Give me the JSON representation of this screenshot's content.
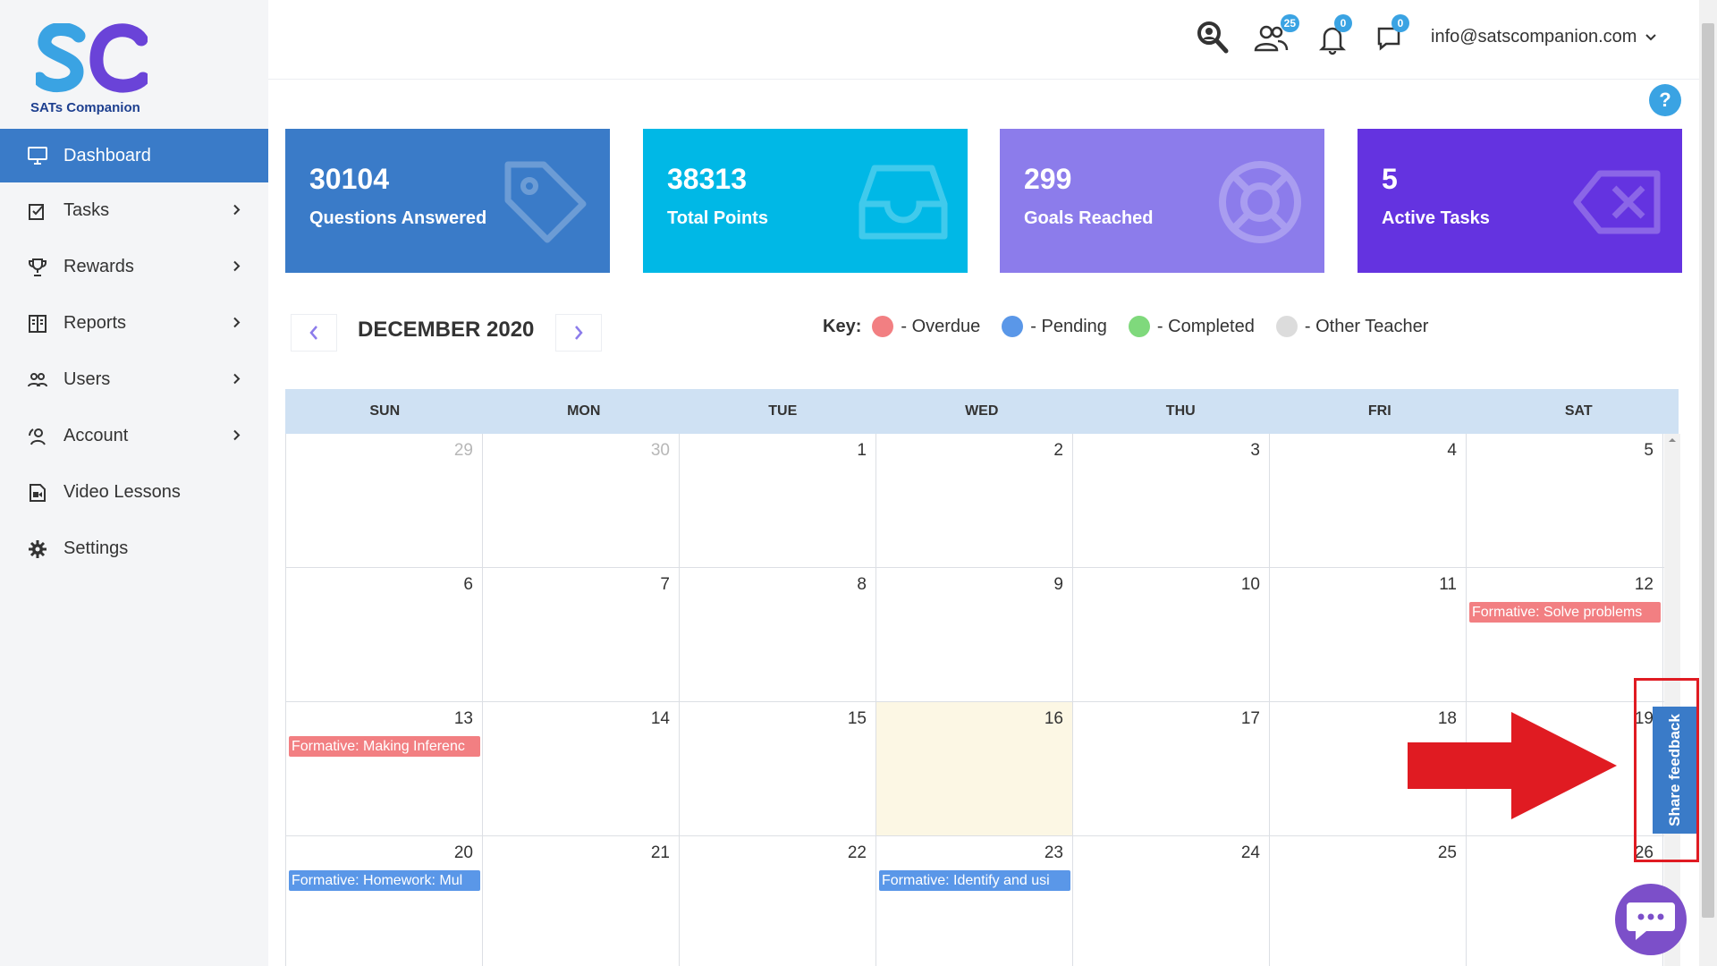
{
  "brand": {
    "name": "SATs Companion",
    "logo_letters": "SC"
  },
  "sidebar": {
    "items": [
      {
        "label": "Dashboard",
        "icon": "monitor-icon",
        "active": true
      },
      {
        "label": "Tasks",
        "icon": "tasks-icon"
      },
      {
        "label": "Rewards",
        "icon": "trophy-icon"
      },
      {
        "label": "Reports",
        "icon": "reports-icon"
      },
      {
        "label": "Users",
        "icon": "users-icon"
      },
      {
        "label": "Account",
        "icon": "account-icon"
      },
      {
        "label": "Video Lessons",
        "icon": "video-icon"
      },
      {
        "label": "Settings",
        "icon": "gear-icon"
      }
    ]
  },
  "topbar": {
    "users_badge": "25",
    "notifications_badge": "0",
    "messages_badge": "0",
    "user_email": "info@satscompanion.com",
    "help_label": "?"
  },
  "stats": [
    {
      "value": "30104",
      "label": "Questions Answered",
      "color": "#3a7bc8"
    },
    {
      "value": "38313",
      "label": "Total Points",
      "color": "#00b8e6"
    },
    {
      "value": "299",
      "label": "Goals Reached",
      "color": "#8c7ceb"
    },
    {
      "value": "5",
      "label": "Active Tasks",
      "color": "#6433e0"
    }
  ],
  "calendar": {
    "month_label": "DECEMBER 2020",
    "key": {
      "title": "Key:",
      "items": [
        {
          "label": "- Overdue",
          "color": "#f27f82"
        },
        {
          "label": "- Pending",
          "color": "#5a97e8"
        },
        {
          "label": "- Completed",
          "color": "#7fd97c"
        },
        {
          "label": "- Other Teacher",
          "color": "#dcdcdc"
        }
      ]
    },
    "weekdays": [
      "SUN",
      "MON",
      "TUE",
      "WED",
      "THU",
      "FRI",
      "SAT"
    ],
    "weeks": [
      [
        "29",
        "30",
        "1",
        "2",
        "3",
        "4",
        "5"
      ],
      [
        "6",
        "7",
        "8",
        "9",
        "10",
        "11",
        "12"
      ],
      [
        "13",
        "14",
        "15",
        "16",
        "17",
        "18",
        "19"
      ],
      [
        "20",
        "21",
        "22",
        "23",
        "24",
        "25",
        "26"
      ]
    ],
    "events": {
      "w1_sat": "Formative: Solve problems",
      "w2_sun": "Formative: Making Inferenc",
      "w3_sun": "Formative: Homework: Mul",
      "w3_wed": "Formative: Identify and usi"
    }
  },
  "feedback": {
    "label": "Share feedback"
  }
}
